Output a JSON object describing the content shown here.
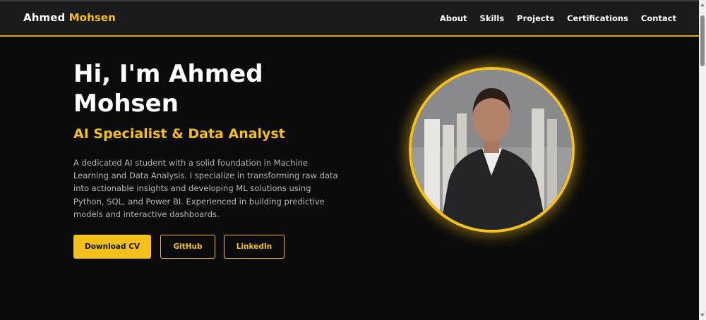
{
  "nav": {
    "brand_first": "Ahmed",
    "brand_last": "Mohsen",
    "links": [
      "About",
      "Skills",
      "Projects",
      "Certifications",
      "Contact"
    ]
  },
  "hero": {
    "title": "Hi, I'm Ahmed Mohsen",
    "subtitle": "AI Specialist & Data Analyst",
    "description": "A dedicated AI student with a solid foundation in Machine Learning and Data Analysis. I specialize in transforming raw data into actionable insights and developing ML solutions using Python, SQL, and Power BI. Experienced in building predictive models and interactive dashboards.",
    "buttons": {
      "download_cv": "Download CV",
      "github": "GitHub",
      "linkedin": "LinkedIn"
    },
    "portrait_icon": "profile-photo"
  },
  "colors": {
    "accent": "#f4c01a",
    "background": "#0b0b0c",
    "navbar": "#1b1b1d",
    "text": "#ffffff",
    "muted_text": "#b7b7bb"
  }
}
